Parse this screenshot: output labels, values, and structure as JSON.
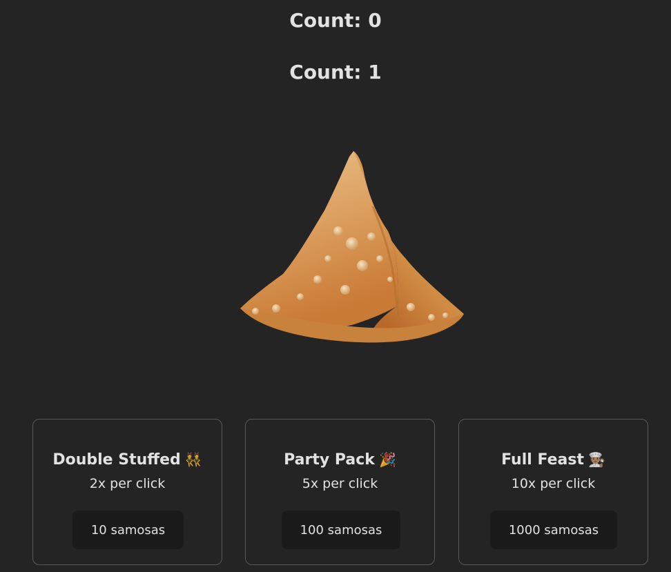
{
  "counts": [
    "Count: 0",
    "Count: 1"
  ],
  "samosa": {
    "alt": "samosa",
    "icon": "samosa-image"
  },
  "upgrades": [
    {
      "title": "Double Stuffed",
      "emoji": "👯",
      "desc": "2x per click",
      "cost": "10 samosas"
    },
    {
      "title": "Party Pack",
      "emoji": "🎉",
      "desc": "5x per click",
      "cost": "100 samosas"
    },
    {
      "title": "Full Feast",
      "emoji": "👨🏽‍🍳",
      "desc": "10x per click",
      "cost": "1000 samosas"
    }
  ],
  "colors": {
    "background": "#242424",
    "text": "#dedede",
    "button_bg": "#1a1a1a",
    "card_border": "#5a5a5a",
    "samosa": "#d9954f"
  }
}
